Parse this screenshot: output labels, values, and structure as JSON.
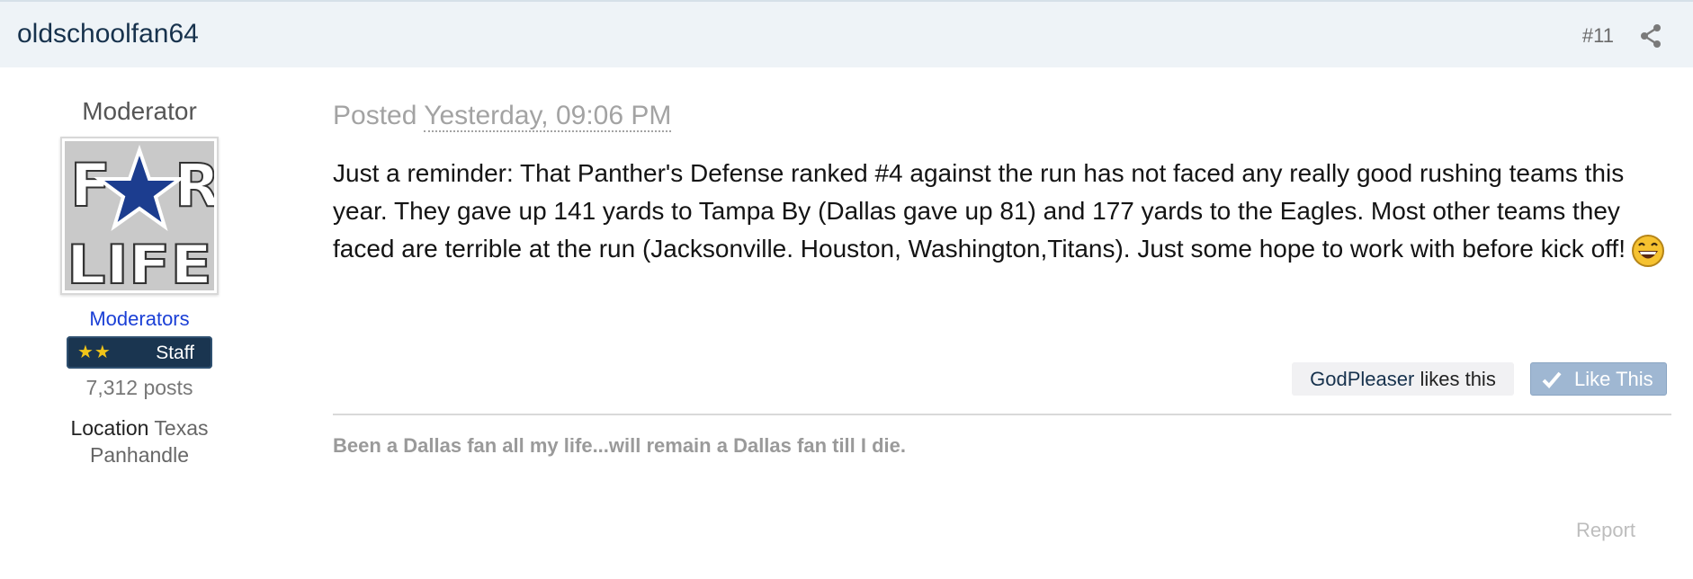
{
  "post": {
    "author": "oldschoolfan64",
    "number": "#11",
    "posted_label": "Posted",
    "posted_date": "Yesterday, 09:06 PM",
    "body": "Just a reminder: That Panther's Defense ranked #4 against the run has not faced any really good rushing teams this year. They gave up 141 yards to Tampa By (Dallas gave up 81) and 177 yards to the Eagles. Most other teams they faced are terrible at the run (Jacksonville. Houston, Washington,Titans). Just some hope to work with before kick off!",
    "signature": "Been a Dallas fan all my life...will remain a Dallas fan till I die.",
    "report_label": "Report"
  },
  "author_info": {
    "member_title": "Moderator",
    "avatar_text": [
      "F",
      "R",
      "LIFE"
    ],
    "group": "Moderators",
    "rank_label": "Staff",
    "rank_stars": "★★",
    "post_count": "7,312 posts",
    "location_label": "Location",
    "location_value": "Texas Panhandle"
  },
  "likes": {
    "liker": "GodPleaser",
    "suffix": " likes this",
    "button_label": "Like This"
  },
  "colors": {
    "header_bg": "#eef3f7",
    "author_link": "#17324d",
    "group_link": "#1a3fd6",
    "like_button": "#9fb7d2",
    "star": "#1c3d8f"
  },
  "icons": [
    "share-icon",
    "star-logo-icon",
    "laughing-emoji-icon",
    "checkmark-icon",
    "rank-stars-icon"
  ]
}
